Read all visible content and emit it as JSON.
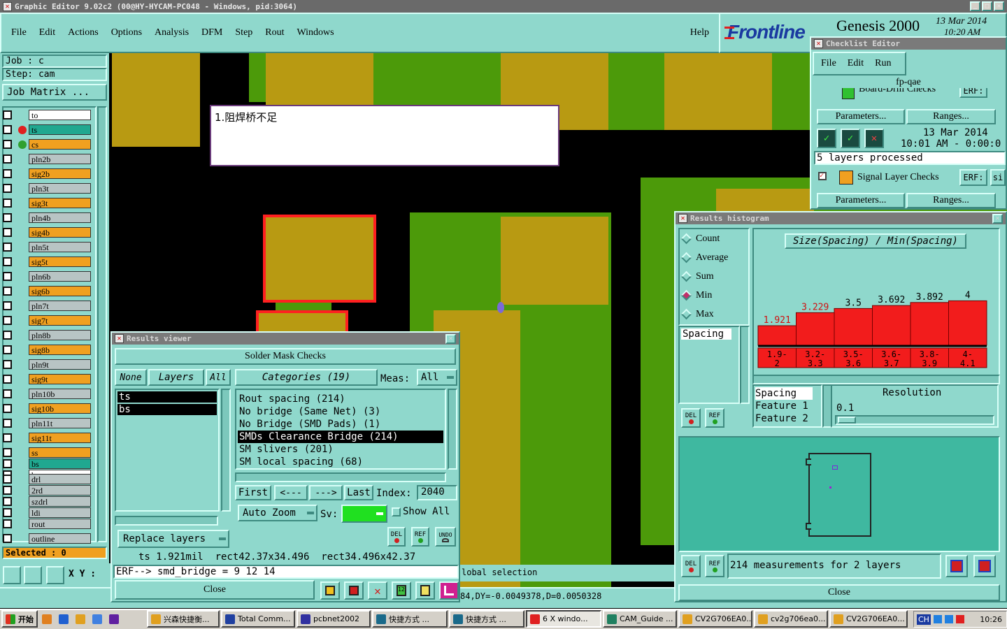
{
  "window": {
    "title": "Graphic Editor 9.02c2 (00@HY-HYCAM-PC048 - Windows, pid:3064)"
  },
  "menu": {
    "items": [
      "File",
      "Edit",
      "Actions",
      "Options",
      "Analysis",
      "DFM",
      "Step",
      "Rout",
      "Windows"
    ],
    "help": "Help"
  },
  "brand": {
    "logo": "Frontline",
    "product": "Genesis 2000",
    "date": "13 Mar 2014",
    "time": "10:20 AM"
  },
  "job": {
    "job_label": "Job : c",
    "step_label": "Step: cam",
    "matrix_button": "Job Matrix ..."
  },
  "layers": [
    {
      "name": "to",
      "color": "white",
      "mark": ""
    },
    {
      "name": "ts",
      "color": "green",
      "mark": "red"
    },
    {
      "name": "cs",
      "color": "orange",
      "mark": "green"
    },
    {
      "name": "pln2b",
      "color": "gray"
    },
    {
      "name": "sig2b",
      "color": "orange"
    },
    {
      "name": "pln3t",
      "color": "gray"
    },
    {
      "name": "sig3t",
      "color": "orange"
    },
    {
      "name": "pln4b",
      "color": "gray"
    },
    {
      "name": "sig4b",
      "color": "orange"
    },
    {
      "name": "pln5t",
      "color": "gray"
    },
    {
      "name": "sig5t",
      "color": "orange"
    },
    {
      "name": "pln6b",
      "color": "gray"
    },
    {
      "name": "sig6b",
      "color": "orange"
    },
    {
      "name": "pln7t",
      "color": "gray"
    },
    {
      "name": "sig7t",
      "color": "orange"
    },
    {
      "name": "pln8b",
      "color": "gray"
    },
    {
      "name": "sig8b",
      "color": "orange"
    },
    {
      "name": "pln9t",
      "color": "gray"
    },
    {
      "name": "sig9t",
      "color": "orange"
    },
    {
      "name": "pln10b",
      "color": "gray"
    },
    {
      "name": "sig10b",
      "color": "orange"
    },
    {
      "name": "pln11t",
      "color": "gray"
    },
    {
      "name": "sig11t",
      "color": "orange"
    },
    {
      "name": "ss",
      "color": "orange"
    },
    {
      "name": "bs",
      "color": "green"
    },
    {
      "name": "bo",
      "color": "white"
    },
    {
      "name": "drl",
      "color": "gray"
    },
    {
      "name": "2rd",
      "color": "gray"
    },
    {
      "name": "szdrl",
      "color": "gray"
    },
    {
      "name": "ldi",
      "color": "gray"
    },
    {
      "name": "rout",
      "color": "gray"
    },
    {
      "name": "outline",
      "color": "gray"
    }
  ],
  "selected": "Selected : 0",
  "xy_label": "X Y :",
  "annotation": {
    "text": "1.阻焊桥不足"
  },
  "status_selection": "lobal selection",
  "status_coords": "84,DY=-0.0049378,D=0.0050328",
  "results_viewer": {
    "title": "Results viewer",
    "header": "Solder Mask Checks",
    "none": "None",
    "layers": "Layers",
    "all": "All",
    "categories": "Categories (19)",
    "meas_label": "Meas:",
    "meas_value": "All",
    "layer_list": [
      "ts",
      "bs"
    ],
    "category_list": [
      "Rout spacing (214)",
      "No bridge (Same Net) (3)",
      "No Bridge (SMD Pads) (1)",
      "SMDs Clearance Bridge (214)",
      "SM slivers (201)",
      "SM local spacing (68)"
    ],
    "selected_category": 3,
    "nav": {
      "first": "First",
      "prev": "<---",
      "next": "--->",
      "last": "Last",
      "index_label": "Index:",
      "index_value": "2040"
    },
    "auto_zoom": "Auto Zoom",
    "sv_label": "Sv:",
    "show_all": "Show All",
    "replace_layers": "Replace layers",
    "icons": {
      "del": "DEL",
      "ref": "REF",
      "undo": "UNDO"
    },
    "measure_line": "ts 1.921mil  rect42.37x34.496  rect34.496x42.37",
    "erf_line": "ERF--> smd_bridge = 9 12 14",
    "close": "Close"
  },
  "checklist": {
    "title": "Checklist Editor",
    "menu": [
      "File",
      "Edit",
      "Run"
    ],
    "name": "fp-qae",
    "item1": "Board-Drill Checks",
    "erf": "ERF:",
    "parameters": "Parameters...",
    "ranges": "Ranges...",
    "date": "13 Mar 2014",
    "time": "10:01 AM - 0:00:0",
    "processed": "5 layers processed",
    "item2": "Signal Layer Checks",
    "si": "si"
  },
  "histogram": {
    "title": "Results histogram",
    "modes": [
      "Count",
      "Average",
      "Sum",
      "Min",
      "Max"
    ],
    "selected_mode": "Min",
    "chart_title": "Size(Spacing) / Min(Spacing)",
    "list_item": "Spacing",
    "features": [
      "Spacing",
      "Feature 1",
      "Feature 2"
    ],
    "resolution_label": "Resolution",
    "resolution_value": "0.1",
    "measurements": "214 measurements for 2 layers",
    "close": "Close"
  },
  "chart_data": {
    "type": "bar",
    "title": "Size(Spacing) / Min(Spacing)",
    "categories": [
      "1.9-2",
      "3.2-3.3",
      "3.5-3.6",
      "3.6-3.7",
      "3.8-3.9",
      "4-4.1"
    ],
    "values": [
      1.921,
      3.229,
      3.5,
      3.692,
      3.892,
      4
    ],
    "value_labels": [
      "1.921",
      "3.229",
      "3.5",
      "3.692",
      "3.892",
      "4"
    ],
    "bar_color": "#f21c1c",
    "ylim": [
      0,
      4.5
    ]
  },
  "taskbar": {
    "start": "开始",
    "items": [
      "兴森快捷衡...",
      "Total Comm...",
      "pcbnet2002",
      "快捷方式 ...",
      "快捷方式 ...",
      "6 X windo...",
      "CAM_Guide ...",
      "CV2G706EA0...",
      "cv2g706ea0...",
      "CV2G706EA0..."
    ],
    "lang": "CH",
    "clock": "10:26"
  },
  "colors": {
    "canvas": "#000000",
    "copper": "#b89a12",
    "mask": "#4c9a0a",
    "outline": "#ff2020",
    "panel": "#8fd8cc"
  }
}
